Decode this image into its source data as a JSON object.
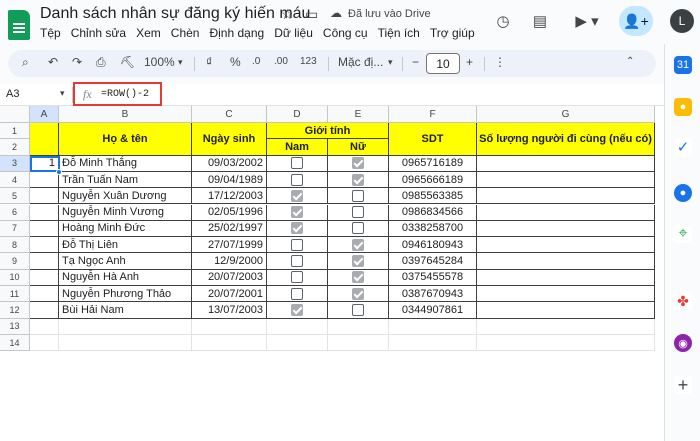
{
  "header": {
    "doc_title": "Danh sách nhân sự đăng ký hiến máu",
    "save_status": "Đã lưu vào Drive",
    "avatar_letter": "L",
    "menu": [
      "Tệp",
      "Chỉnh sửa",
      "Xem",
      "Chèn",
      "Định dạng",
      "Dữ liệu",
      "Công cụ",
      "Tiện ích",
      "Trợ giúp"
    ]
  },
  "toolbar": {
    "zoom": "100%",
    "currency": "₫",
    "percent": "%",
    "dec_decrease": ".0",
    "dec_increase": ".00",
    "number_format": "123",
    "font": "Mặc đị...",
    "font_size": "10",
    "minus": "−",
    "plus": "+"
  },
  "formula_bar": {
    "name_box": "A3",
    "fx": "fx",
    "formula": "=ROW()-2"
  },
  "columns": [
    "A",
    "B",
    "C",
    "D",
    "E",
    "F",
    "G"
  ],
  "rows": [
    "1",
    "2",
    "3",
    "4",
    "5",
    "6",
    "7",
    "8",
    "9",
    "10",
    "11",
    "12",
    "13",
    "14"
  ],
  "headers": {
    "name": "Họ & tên",
    "dob": "Ngày sinh",
    "gender": "Giới tính",
    "male": "Nam",
    "female": "Nữ",
    "phone": "SDT",
    "companions": "Số lượng người đi cùng (nếu có)"
  },
  "records": [
    {
      "no": "1",
      "name": "Đỗ Minh Thắng",
      "dob": "09/03/2002",
      "male": false,
      "female": true,
      "phone": "0965716189"
    },
    {
      "no": "",
      "name": "Trần Tuấn Nam",
      "dob": "09/04/1989",
      "male": false,
      "female": true,
      "phone": "0965666189"
    },
    {
      "no": "",
      "name": "Nguyễn Xuân Dương",
      "dob": "17/12/2003",
      "male": true,
      "female": false,
      "phone": "0985563385"
    },
    {
      "no": "",
      "name": "Nguyễn Minh Vương",
      "dob": "02/05/1996",
      "male": true,
      "female": false,
      "phone": "0986834566"
    },
    {
      "no": "",
      "name": "Hoàng Minh Đức",
      "dob": "25/02/1997",
      "male": true,
      "female": false,
      "phone": "0338258700"
    },
    {
      "no": "",
      "name": "Đỗ Thị Liên",
      "dob": "27/07/1999",
      "male": false,
      "female": true,
      "phone": "0946180943"
    },
    {
      "no": "",
      "name": "Tạ Ngọc Anh",
      "dob": "12/9/2000",
      "male": false,
      "female": true,
      "phone": "0397645284"
    },
    {
      "no": "",
      "name": "Nguyễn Hà Anh",
      "dob": "20/07/2003",
      "male": false,
      "female": true,
      "phone": "0375455578"
    },
    {
      "no": "",
      "name": "Nguyễn Phương Thảo",
      "dob": "20/07/2001",
      "male": false,
      "female": true,
      "phone": "0387670943"
    },
    {
      "no": "",
      "name": "Bùi Hải Nam",
      "dob": "13/07/2003",
      "male": true,
      "female": false,
      "phone": "0344907861"
    }
  ],
  "sidebar_icons": [
    "calendar-icon",
    "keep-icon",
    "tasks-icon",
    "contacts-icon",
    "maps-icon",
    "apps-script-icon",
    "extension-icon",
    "add-icon"
  ]
}
